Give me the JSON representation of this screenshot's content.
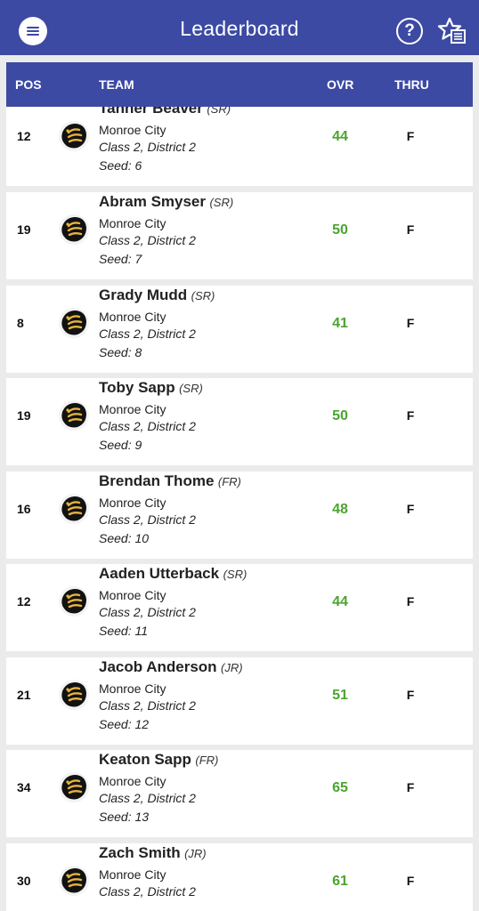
{
  "header": {
    "title": "Leaderboard",
    "help_icon": "question-circle-icon",
    "menu_icon": "hamburger-menu-icon",
    "favorites_icon": "star-list-icon"
  },
  "columns": {
    "pos": "POS",
    "team": "TEAM",
    "ovr": "OVR",
    "thru": "THRU"
  },
  "colors": {
    "brand": "#3c4aa3",
    "score": "#4aa52f"
  },
  "rows": [
    {
      "pos": "12",
      "name": "Tanner Beaver",
      "class": "(SR)",
      "school": "Monroe City",
      "district": "Class 2, District 2",
      "seed": "Seed: 6",
      "ovr": "44",
      "thru": "F"
    },
    {
      "pos": "19",
      "name": "Abram Smyser",
      "class": "(SR)",
      "school": "Monroe City",
      "district": "Class 2, District 2",
      "seed": "Seed: 7",
      "ovr": "50",
      "thru": "F"
    },
    {
      "pos": "8",
      "name": "Grady Mudd",
      "class": "(SR)",
      "school": "Monroe City",
      "district": "Class 2, District 2",
      "seed": "Seed: 8",
      "ovr": "41",
      "thru": "F"
    },
    {
      "pos": "19",
      "name": "Toby Sapp",
      "class": "(SR)",
      "school": "Monroe City",
      "district": "Class 2, District 2",
      "seed": "Seed: 9",
      "ovr": "50",
      "thru": "F"
    },
    {
      "pos": "16",
      "name": "Brendan Thome",
      "class": "(FR)",
      "school": "Monroe City",
      "district": "Class 2, District 2",
      "seed": "Seed: 10",
      "ovr": "48",
      "thru": "F"
    },
    {
      "pos": "12",
      "name": "Aaden Utterback",
      "class": "(SR)",
      "school": "Monroe City",
      "district": "Class 2, District 2",
      "seed": "Seed: 11",
      "ovr": "44",
      "thru": "F"
    },
    {
      "pos": "21",
      "name": "Jacob Anderson",
      "class": "(JR)",
      "school": "Monroe City",
      "district": "Class 2, District 2",
      "seed": "Seed: 12",
      "ovr": "51",
      "thru": "F"
    },
    {
      "pos": "34",
      "name": "Keaton Sapp",
      "class": "(FR)",
      "school": "Monroe City",
      "district": "Class 2, District 2",
      "seed": "Seed: 13",
      "ovr": "65",
      "thru": "F"
    },
    {
      "pos": "30",
      "name": "Zach Smith",
      "class": "(JR)",
      "school": "Monroe City",
      "district": "Class 2, District 2",
      "seed": "",
      "ovr": "61",
      "thru": "F"
    }
  ]
}
